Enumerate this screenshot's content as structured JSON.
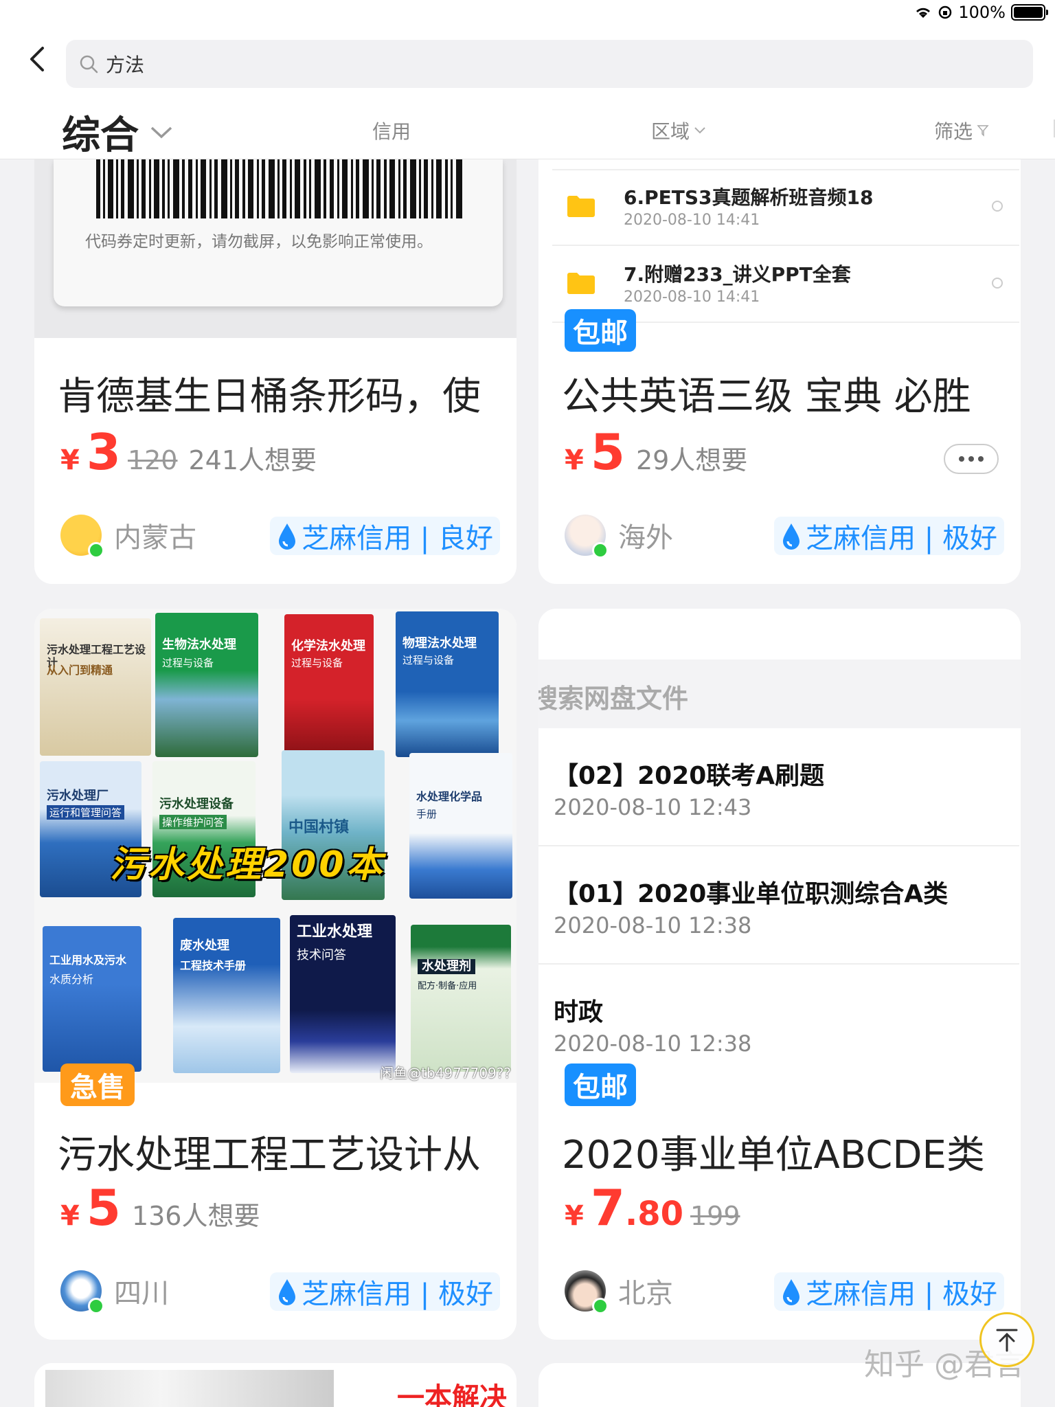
{
  "status": {
    "battery": "100%"
  },
  "search": {
    "query": "方法"
  },
  "tabs": {
    "main": "综合",
    "credit": "信用",
    "region": "区域",
    "filter": "筛选"
  },
  "cards": [
    {
      "coupon_note": "代码券定时更新，请勿截屏，以免影响正常使用。",
      "title": "肯德基生日桶条形码，使",
      "yen": "¥",
      "price": "3",
      "orig_price": "120",
      "wants": "241人想要",
      "location": "内蒙古",
      "credit": "芝麻信用 | 良好"
    },
    {
      "files": [
        {
          "name": "6.PETS3真题解析班音频18",
          "date": "2020-08-10 14:41"
        },
        {
          "name": "7.附赠233_讲义PPT全套",
          "date": "2020-08-10 14:41"
        }
      ],
      "tag": "包邮",
      "title": "公共英语三级 宝典 必胜",
      "yen": "¥",
      "price": "5",
      "wants": "29人想要",
      "location": "海外",
      "credit": "芝麻信用 | 极好"
    },
    {
      "books": [
        {
          "title": "污水处理工程工艺设计",
          "sub": "从入门到精通"
        },
        {
          "title": "生物法水处理",
          "sub": "过程与设备"
        },
        {
          "title": "化学法水处理",
          "sub": "过程与设备"
        },
        {
          "title": "物理法水处理",
          "sub": "过程与设备"
        },
        {
          "title": "污水处理厂",
          "sub": "运行和管理问答"
        },
        {
          "title": "污水处理设备",
          "sub": "操作维护问答"
        },
        {
          "title": "中国村镇",
          "sub": ""
        },
        {
          "title": "水处理化学品",
          "sub": "手册"
        },
        {
          "title": "工业用水及污水",
          "sub": "水质分析"
        },
        {
          "title": "废水处理",
          "sub": "工程技术手册"
        },
        {
          "title": "工业水处理",
          "sub": "技术问答"
        },
        {
          "title": "水处理剂",
          "sub": "配方·制备·应用"
        }
      ],
      "overlay": "污水处理200本",
      "image_watermark": "闲鱼@tb4977709??",
      "tag": "急售",
      "title": "污水处理工程工艺设计从",
      "yen": "¥",
      "price": "5",
      "wants": "136人想要",
      "location": "四川",
      "credit": "芝麻信用 | 极好"
    },
    {
      "header": "搜索网盘文件",
      "docs": [
        {
          "name": "【02】2020联考A刷题",
          "date": "2020-08-10  12:43"
        },
        {
          "name": "【01】2020事业单位职测综合A类",
          "date": "2020-08-10  12:38"
        },
        {
          "name": "时政",
          "date": "2020-08-10  12:38"
        }
      ],
      "tag": "包邮",
      "title": "2020事业单位ABCDE类",
      "yen": "¥",
      "price": "7",
      "price_dec": ".80",
      "orig_price": "199",
      "location": "北京",
      "credit": "芝麻信用 | 极好"
    }
  ],
  "bottom": {
    "ad_text": "一本解决"
  },
  "watermark": "知乎 @君言",
  "colors": {
    "price": "#ff3b30",
    "credit": "#1e8fff",
    "tag_blue": "#1890ff",
    "tag_orange": "#ff9a1a"
  }
}
